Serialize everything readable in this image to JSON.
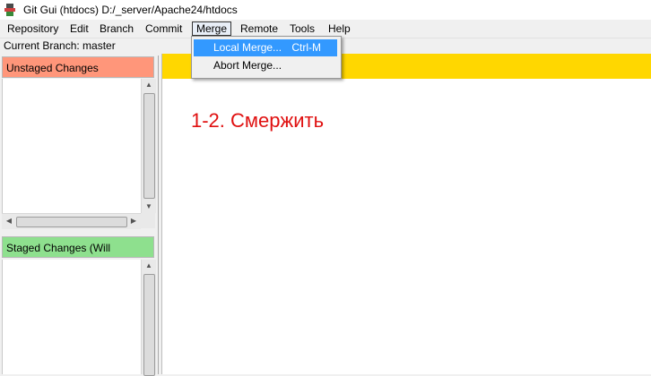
{
  "window": {
    "title": "Git Gui (htdocs) D:/_server/Apache24/htdocs",
    "icon": "git-gui-icon"
  },
  "menubar": {
    "items": [
      "Repository",
      "Edit",
      "Branch",
      "Commit",
      "Merge",
      "Remote",
      "Tools",
      "Help"
    ],
    "active": "Merge"
  },
  "merge_menu": {
    "items": [
      {
        "label": "Local Merge...",
        "shortcut": "Ctrl-M"
      },
      {
        "label": "Abort Merge...",
        "shortcut": ""
      }
    ]
  },
  "branch": {
    "label": "Current Branch: master"
  },
  "panels": {
    "unstaged_title": "Unstaged Changes",
    "staged_title": "Staged Changes (Will Commit)"
  },
  "annotation": {
    "text": "1-2. Смержить"
  },
  "colors": {
    "unstaged_header": "#ff967a",
    "staged_header": "#8ee08e",
    "diff_header": "#ffd700",
    "annotation": "#e01010",
    "menu_highlight": "#3399ff"
  }
}
